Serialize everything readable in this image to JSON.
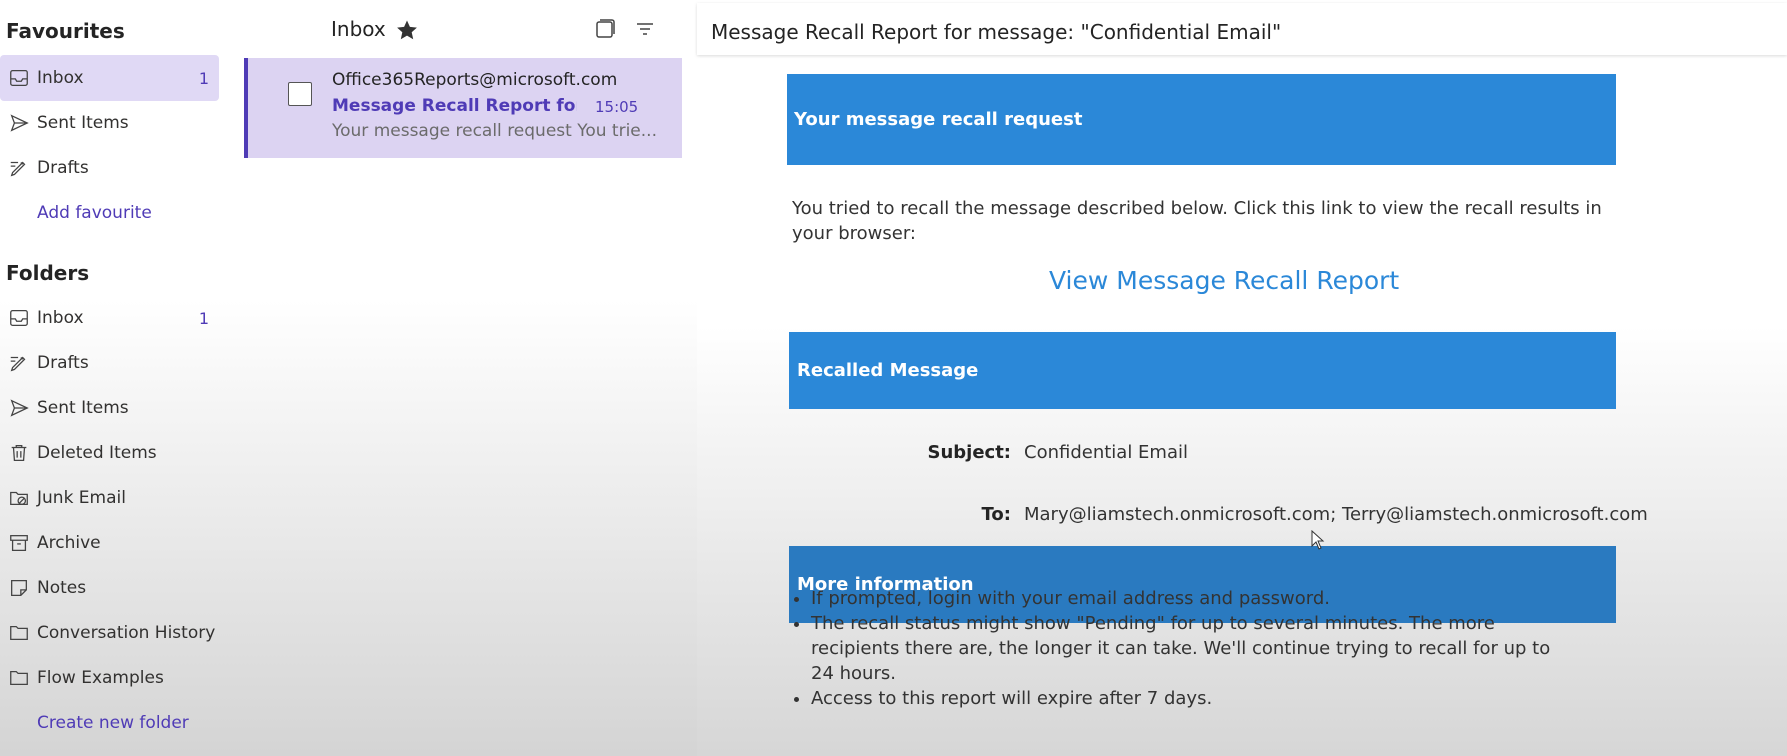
{
  "sidebar": {
    "favourites_title": "Favourites",
    "favourites": [
      {
        "label": "Inbox",
        "count": "1",
        "icon": "inbox-icon"
      },
      {
        "label": "Sent Items",
        "count": "",
        "icon": "send-icon"
      },
      {
        "label": "Drafts",
        "count": "",
        "icon": "pencil-icon"
      }
    ],
    "add_favourite": "Add favourite",
    "folders_title": "Folders",
    "folders": [
      {
        "label": "Inbox",
        "count": "1",
        "icon": "inbox-icon"
      },
      {
        "label": "Drafts",
        "count": "",
        "icon": "pencil-icon"
      },
      {
        "label": "Sent Items",
        "count": "",
        "icon": "send-icon"
      },
      {
        "label": "Deleted Items",
        "count": "",
        "icon": "trash-icon"
      },
      {
        "label": "Junk Email",
        "count": "",
        "icon": "junk-folder-icon"
      },
      {
        "label": "Archive",
        "count": "",
        "icon": "archive-icon"
      },
      {
        "label": "Notes",
        "count": "",
        "icon": "notes-icon"
      },
      {
        "label": "Conversation History",
        "count": "",
        "icon": "folder-icon"
      },
      {
        "label": "Flow Examples",
        "count": "",
        "icon": "folder-icon"
      }
    ],
    "create_folder": "Create new folder"
  },
  "message_list": {
    "title": "Inbox",
    "items": [
      {
        "sender": "Office365Reports@microsoft.com",
        "subject": "Message Recall Report for m...",
        "time": "15:05",
        "preview": "Your message recall request You trie..."
      }
    ]
  },
  "reading_pane": {
    "title": "Message Recall Report for message: \"Confidential Email\"",
    "email": {
      "banner_request": "Your message recall request",
      "intro": "You tried to recall the message described below. Click this link to view the recall results in your browser:",
      "link_text": "View Message Recall Report",
      "banner_recalled": "Recalled Message",
      "subject_label": "Subject:",
      "subject_value": "Confidential Email",
      "to_label": "To:",
      "to_value": "Mary@liamstech.onmicrosoft.com; Terry@liamstech.onmicrosoft.com",
      "banner_more": "More information",
      "info_items": [
        "If prompted, login with your email address and password.",
        "The recall status might show \"Pending\" for up to several minutes. The more recipients there are, the longer it can take. We'll continue trying to recall for up to 24 hours.",
        "Access to this report will expire after 7 days."
      ]
    }
  },
  "colors": {
    "accent": "#4f3bb6",
    "selected_bg": "#e0d9f5",
    "banner_blue": "#2b88d8"
  }
}
